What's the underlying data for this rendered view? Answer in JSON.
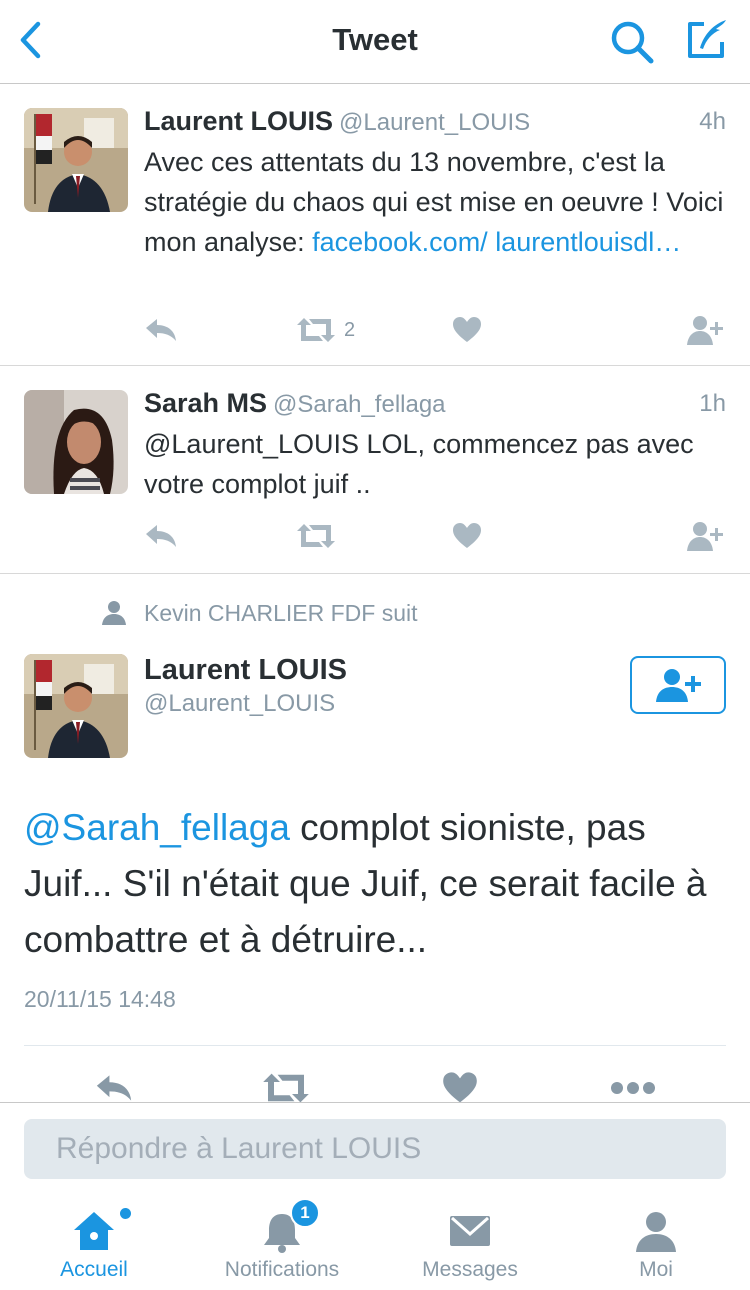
{
  "colors": {
    "accent": "#1b95e0",
    "icon_gray": "#aab8c2",
    "text_gray": "#8899a6"
  },
  "nav": {
    "title": "Tweet",
    "back_icon": "chevron-left-icon",
    "search_icon": "search-icon",
    "compose_icon": "compose-icon"
  },
  "tweets": [
    {
      "name": "Laurent LOUIS",
      "handle": "@Laurent_LOUIS",
      "time": "4h",
      "text": "Avec ces attentats du 13 novembre, c'est la stratégie du chaos qui est mise en oeuvre ! Voici mon analyse: ",
      "link": "facebook.com/ laurentlouisdl…",
      "retweet_count": "2"
    },
    {
      "name": "Sarah MS",
      "handle": "@Sarah_fellaga",
      "time": "1h",
      "text": "@Laurent_LOUIS LOL, commencez pas avec votre complot juif ..",
      "retweet_count": ""
    }
  ],
  "detail": {
    "social_context": "Kevin CHARLIER FDF suit",
    "name": "Laurent LOUIS",
    "handle": "@Laurent_LOUIS",
    "mention": "@Sarah_fellaga",
    "text": " complot sioniste, pas Juif... S'il n'était que Juif, ce serait facile à combattre et à détruire...",
    "date": "20/11/15 14:48"
  },
  "reply": {
    "placeholder": "Répondre à Laurent LOUIS"
  },
  "tabs": [
    {
      "label": "Accueil",
      "icon": "home-icon",
      "active": true
    },
    {
      "label": "Notifications",
      "icon": "bell-icon",
      "badge": "1"
    },
    {
      "label": "Messages",
      "icon": "envelope-icon"
    },
    {
      "label": "Moi",
      "icon": "person-icon"
    }
  ]
}
